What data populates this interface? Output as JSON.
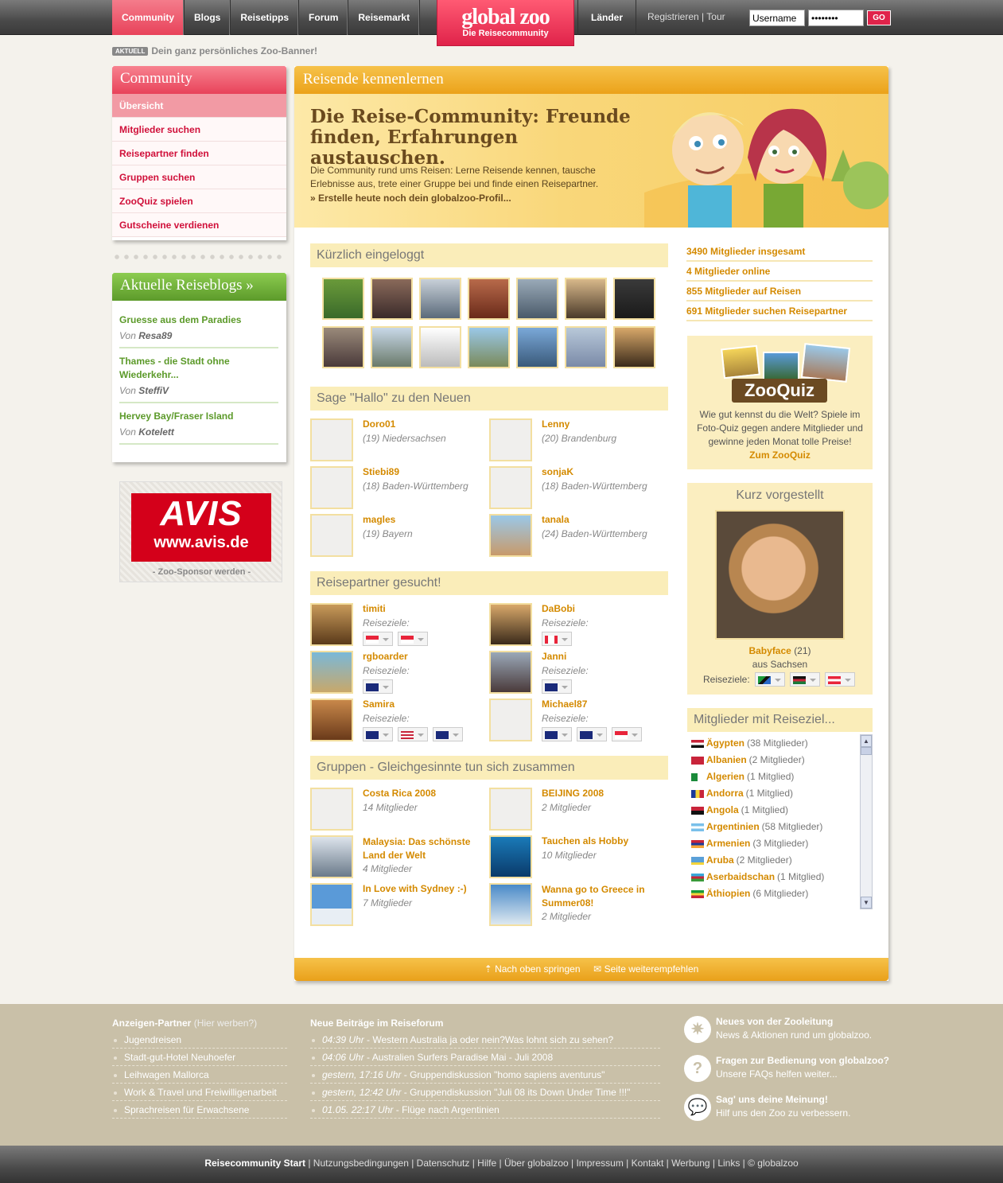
{
  "nav": {
    "items": [
      "Community",
      "Blogs",
      "Reisetipps",
      "Forum",
      "Reisemarkt"
    ],
    "laender": "Länder",
    "registrieren": "Registrieren",
    "sep": "|",
    "tour": "Tour"
  },
  "logo": {
    "line1": "global zoo",
    "line2": "Die Reisecommunity"
  },
  "login": {
    "username": "Username",
    "password": "••••••••",
    "go": "GO"
  },
  "aktuell": {
    "badge": "AKTUELL",
    "text": "Dein ganz persönliches Zoo-Banner!"
  },
  "sidebar": {
    "title": "Community",
    "items": [
      "Übersicht",
      "Mitglieder suchen",
      "Reisepartner finden",
      "Gruppen suchen",
      "ZooQuiz spielen",
      "Gutscheine verdienen"
    ],
    "blogs_title": "Aktuelle Reiseblogs »",
    "blogs": [
      {
        "title": "Gruesse aus dem Paradies",
        "by": "Von",
        "author": "Resa89"
      },
      {
        "title": "Thames - die Stadt ohne Wiederkehr...",
        "by": "Von",
        "author": "SteffiV"
      },
      {
        "title": "Hervey Bay/Fraser Island",
        "by": "Von",
        "author": "Kotelett"
      }
    ],
    "sponsor": "- Zoo-Sponsor werden -",
    "avis1": "AVIS",
    "avis2": "www.avis.de"
  },
  "main": {
    "title": "Reisende kennenlernen",
    "hero_h1": "Die Reise-Community: Freunde finden, Erfahrungen austauschen.",
    "hero_p": "Die Community rund ums Reisen: Lerne Reisende kennen, tausche Erlebnisse aus, trete einer Gruppe bei und finde einen Reisepartner.",
    "hero_cta": "» Erstelle heute noch dein globalzoo-Profil...",
    "sec_logged": "Kürzlich eingeloggt",
    "sec_hallo": "Sage \"Hallo\" zu den Neuen",
    "new_members": [
      {
        "name": "Doro01",
        "info": "(19) Niedersachsen"
      },
      {
        "name": "Lenny",
        "info": "(20) Brandenburg"
      },
      {
        "name": "Stiebi89",
        "info": "(18) Baden-Württemberg"
      },
      {
        "name": "sonjaK",
        "info": "(18) Baden-Württemberg"
      },
      {
        "name": "magles",
        "info": "(19) Bayern"
      },
      {
        "name": "tanala",
        "info": "(24) Baden-Württemberg"
      }
    ],
    "sec_partner": "Reisepartner gesucht!",
    "reiseziele": "Reiseziele:",
    "partners": [
      {
        "name": "timiti"
      },
      {
        "name": "DaBobi"
      },
      {
        "name": "rgboarder"
      },
      {
        "name": "Janni"
      },
      {
        "name": "Samira"
      },
      {
        "name": "Michael87"
      }
    ],
    "sec_groups": "Gruppen - Gleichgesinnte tun sich zusammen",
    "groups": [
      {
        "name": "Costa Rica 2008",
        "info": "14 Mitglieder"
      },
      {
        "name": "BEIJING 2008",
        "info": "2 Mitglieder"
      },
      {
        "name": "Malaysia: Das schönste Land der Welt",
        "info": "4 Mitglieder"
      },
      {
        "name": "Tauchen als Hobby",
        "info": "10 Mitglieder"
      },
      {
        "name": "In Love with Sydney :-)",
        "info": "7 Mitglieder"
      },
      {
        "name": "Wanna go to Greece in Summer08!",
        "info": "2 Mitglieder"
      }
    ],
    "stats": [
      "3490 Mitglieder insgesamt",
      "4 Mitglieder online",
      "855 Mitglieder auf Reisen",
      "691 Mitglieder suchen Reisepartner"
    ],
    "quiz": {
      "logo": "ZooQuiz",
      "text": "Wie gut kennst du die Welt? Spiele im Foto-Quiz gegen andere Mitglieder und gewinne jeden Monat tolle Preise!",
      "link": "Zum ZooQuiz"
    },
    "kurz": {
      "title": "Kurz vorgestellt",
      "name": "Babyface",
      "age": "(21)",
      "from": "aus Sachsen",
      "rz": "Reiseziele:"
    },
    "mlist": {
      "title": "Mitglieder mit Reiseziel...",
      "items": [
        {
          "c": "Ägypten",
          "n": "(38 Mitglieder)"
        },
        {
          "c": "Albanien",
          "n": "(2 Mitglieder)"
        },
        {
          "c": "Algerien",
          "n": "(1 Mitglied)"
        },
        {
          "c": "Andorra",
          "n": "(1 Mitglied)"
        },
        {
          "c": "Angola",
          "n": "(1 Mitglied)"
        },
        {
          "c": "Argentinien",
          "n": "(58 Mitglieder)"
        },
        {
          "c": "Armenien",
          "n": "(3 Mitglieder)"
        },
        {
          "c": "Aruba",
          "n": "(2 Mitglieder)"
        },
        {
          "c": "Aserbaidschan",
          "n": "(1 Mitglied)"
        },
        {
          "c": "Äthiopien",
          "n": "(6 Mitglieder)"
        }
      ]
    },
    "foot_top": "Nach oben springen",
    "foot_rec": "Seite weiterempfehlen"
  },
  "footer": {
    "ads_title": "Anzeigen-Partner",
    "ads_hint": "(Hier werben?)",
    "ads": [
      "Jugendreisen",
      "Stadt-gut-Hotel Neuhoefer",
      "Leihwagen Mallorca",
      "Work & Travel und Freiwilligenarbeit",
      "Sprachreisen für Erwachsene"
    ],
    "forum_title": "Neue Beiträge im Reiseforum",
    "forum": [
      {
        "t": "04:39 Uhr",
        "s": " - Western Australia ja oder nein?Was lohnt sich zu sehen?"
      },
      {
        "t": "04:06 Uhr",
        "s": " - Australien Surfers Paradise Mai - Juli 2008"
      },
      {
        "t": "gestern, 17:16 Uhr",
        "s": " - Gruppendiskussion \"homo sapiens aventurus\""
      },
      {
        "t": "gestern, 12:42 Uhr",
        "s": " - Gruppendiskussion \"Juli 08 its Down Under Time !!!\""
      },
      {
        "t": "01.05. 22:17 Uhr",
        "s": " - Flüge nach Argentinien"
      }
    ],
    "info": [
      {
        "t": "Neues von der Zooleitung",
        "s": "News & Aktionen rund um globalzoo."
      },
      {
        "t": "Fragen zur Bedienung von globalzoo?",
        "s": "Unsere FAQs helfen weiter..."
      },
      {
        "t": "Sag' uns deine Meinung!",
        "s": "Hilf uns den Zoo zu verbessern."
      }
    ],
    "bottom_start": "Reisecommunity Start",
    "bottom_links": " | Nutzungsbedingungen | Datenschutz | Hilfe | Über globalzoo | Impressum | Kontakt | Werbung | Links | © globalzoo"
  },
  "colors": {
    "accent": "#e0234a",
    "orange": "#d48a00",
    "green": "#5c9a2a"
  }
}
